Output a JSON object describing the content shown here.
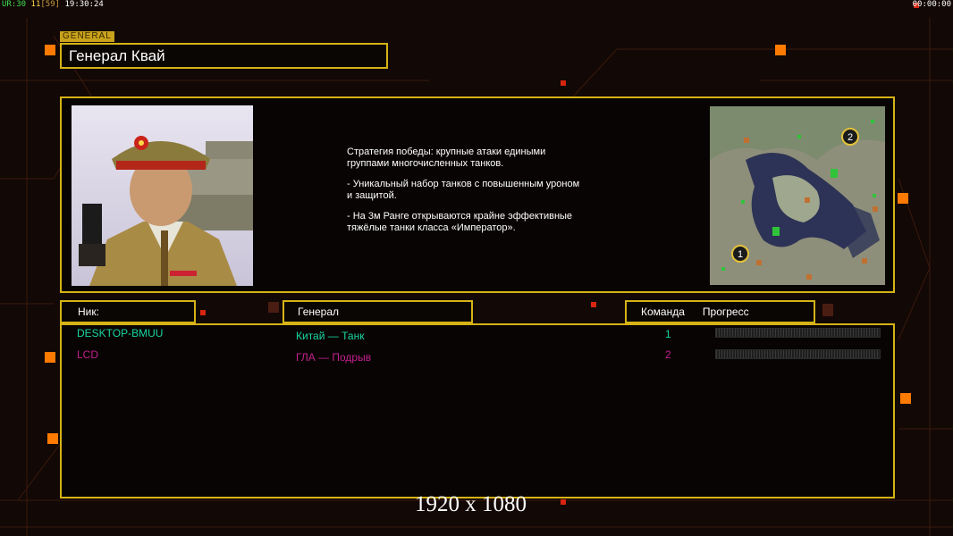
{
  "hud": {
    "left_fps_label": "UR:",
    "left_fps": "30",
    "left_a": "11",
    "left_b": "[59]",
    "left_time": "19:30:24",
    "right_time": "00:00:00"
  },
  "general": {
    "tag": "GENERAL",
    "name": "Генерал Квай",
    "description": [
      "Стратегия победы: крупные атаки едиными\n группами многочисленных танков.",
      "- Уникальный набор танков с повышенным уроном\n и защитой.",
      "- На 3м Ранге открываются крайне эффективные\n тяжёлые танки класса «Император»."
    ]
  },
  "table": {
    "headers": {
      "nick": "Ник:",
      "general": "Генерал",
      "team": "Команда",
      "progress": "Прогресс"
    },
    "rows": [
      {
        "nick": "DESKTOP-BMUU",
        "general": "Китай — Танк",
        "team": "1",
        "progress": 0,
        "color": "#19d6a0"
      },
      {
        "nick": "LCD",
        "general": "ГЛА — Подрыв",
        "team": "2",
        "progress": 0,
        "color": "#c4208f"
      }
    ]
  },
  "minimap": {
    "markers": [
      "1",
      "2"
    ]
  },
  "resolution": "1920 x 1080",
  "colors": {
    "frame": "#d6b316",
    "background": "#120806",
    "accent": "#ff7a00"
  }
}
